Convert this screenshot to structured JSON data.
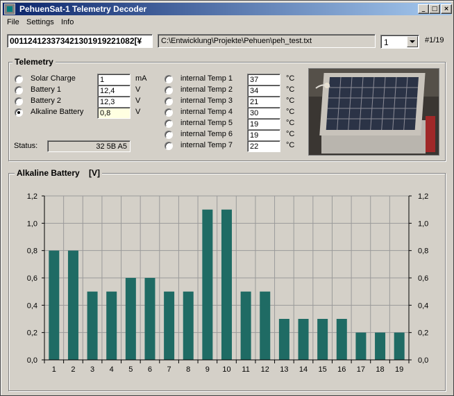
{
  "window": {
    "title": "PehuenSat-1 Telemetry Decoder",
    "controls": {
      "minimize": "_",
      "maximize": "□",
      "close": "×"
    }
  },
  "menu": {
    "items": [
      "File",
      "Settings",
      "Info"
    ]
  },
  "toolbar": {
    "hex_value": "001124123373421301919221082[¥",
    "file_path": "C:\\Entwicklung\\Projekte\\Pehuen\\peh_test.txt",
    "frame_select": "1",
    "frame_counter": "#1/19"
  },
  "telemetry": {
    "title": "Telemetry",
    "power": [
      {
        "label": "Solar Charge",
        "value": "1",
        "unit": "mA",
        "checked": false
      },
      {
        "label": "Battery 1",
        "value": "12,4",
        "unit": "V",
        "checked": false
      },
      {
        "label": "Battery 2",
        "value": "12,3",
        "unit": "V",
        "checked": false
      },
      {
        "label": "Alkaline Battery",
        "value": "0,8",
        "unit": "V",
        "checked": true
      }
    ],
    "temps": [
      {
        "label": "internal Temp 1",
        "value": "37",
        "unit": "°C"
      },
      {
        "label": "internal Temp 2",
        "value": "34",
        "unit": "°C"
      },
      {
        "label": "internal Temp 3",
        "value": "21",
        "unit": "°C"
      },
      {
        "label": "internal Temp 4",
        "value": "30",
        "unit": "°C"
      },
      {
        "label": "internal Temp 5",
        "value": "19",
        "unit": "°C"
      },
      {
        "label": "internal Temp 6",
        "value": "19",
        "unit": "°C"
      },
      {
        "label": "internal Temp 7",
        "value": "22",
        "unit": "°C"
      }
    ],
    "status_label": "Status:",
    "status_value": "32 5B A5"
  },
  "chart_section": {
    "title": "Alkaline Battery    [V]"
  },
  "colors": {
    "bar": "#1f6b64",
    "titlebar_start": "#0a246a",
    "titlebar_end": "#a6caf0"
  },
  "chart_data": {
    "type": "bar",
    "categories": [
      "1",
      "2",
      "3",
      "4",
      "5",
      "6",
      "7",
      "8",
      "9",
      "10",
      "11",
      "12",
      "13",
      "14",
      "15",
      "16",
      "17",
      "18",
      "19"
    ],
    "values": [
      0.8,
      0.8,
      0.5,
      0.5,
      0.6,
      0.6,
      0.5,
      0.5,
      1.1,
      1.1,
      0.5,
      0.5,
      0.3,
      0.3,
      0.3,
      0.3,
      0.2,
      0.2,
      0.2
    ],
    "ylim": [
      0,
      1.2
    ],
    "yticks": [
      "0,0",
      "0,2",
      "0,4",
      "0,6",
      "0,8",
      "1,0",
      "1,2"
    ],
    "grid": true,
    "axes": "left-and-right"
  }
}
